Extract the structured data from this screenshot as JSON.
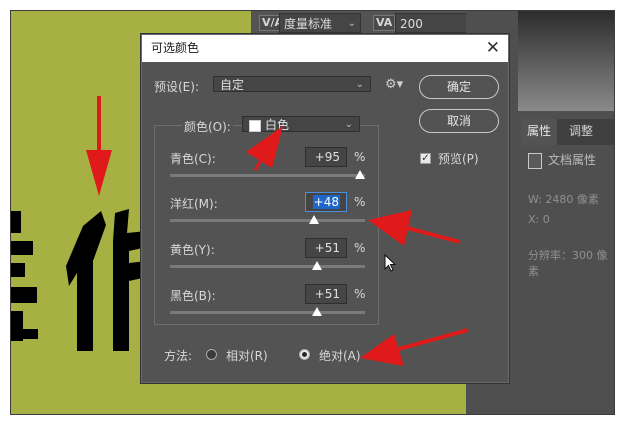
{
  "toolbar": {
    "kerning_icon": "V/A",
    "kerning_value": "度量标准",
    "tracking_icon": "VA",
    "tracking_value": "200"
  },
  "canvas": {
    "bg_color": "#a7b143",
    "art_color": "#000000",
    "arrow_color": "#e01a1a"
  },
  "properties_panel": {
    "tabs": [
      "属性",
      "调整"
    ],
    "doc_label": "文档属性",
    "width": "W:  2480 像素",
    "x": "X:  0",
    "resolution": "分辨率：300 像素"
  },
  "dialog": {
    "title": "可选颜色",
    "preset_label": "预设(E):",
    "preset_value": "自定",
    "ok_label": "确定",
    "cancel_label": "取消",
    "preview_label": "预览(P)",
    "preview_checked": true,
    "colors_label": "颜色(O):",
    "colors_value": "白色",
    "sliders": [
      {
        "label": "青色(C):",
        "value": "+95",
        "unit": "%",
        "level": 95
      },
      {
        "label": "洋红(M):",
        "value": "+48",
        "unit": "%",
        "level": 48
      },
      {
        "label": "黄色(Y):",
        "value": "+51",
        "unit": "%",
        "level": 51
      },
      {
        "label": "黑色(B):",
        "value": "+51",
        "unit": "%",
        "level": 51
      }
    ],
    "method_label": "方法:",
    "method_options": [
      {
        "label": "相对(R)",
        "selected": false
      },
      {
        "label": "绝对(A)",
        "selected": true
      }
    ]
  }
}
